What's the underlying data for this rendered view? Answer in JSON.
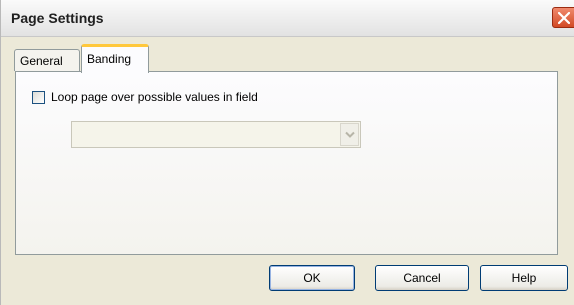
{
  "window": {
    "title": "Page Settings"
  },
  "tabs": [
    {
      "label": "General",
      "selected": false
    },
    {
      "label": "Banding",
      "selected": true
    }
  ],
  "banding": {
    "loop_checkbox": {
      "label": "Loop page over possible values in field",
      "checked": false
    },
    "field_select": {
      "value": "",
      "disabled": true
    }
  },
  "buttons": {
    "ok": "OK",
    "cancel": "Cancel",
    "help": "Help"
  },
  "colors": {
    "tab_highlight": "#ffc83c",
    "close_button": "#d24a25",
    "button_border": "#003c74"
  },
  "icons": {
    "close": "close-icon",
    "dropdown": "chevron-down-icon"
  }
}
